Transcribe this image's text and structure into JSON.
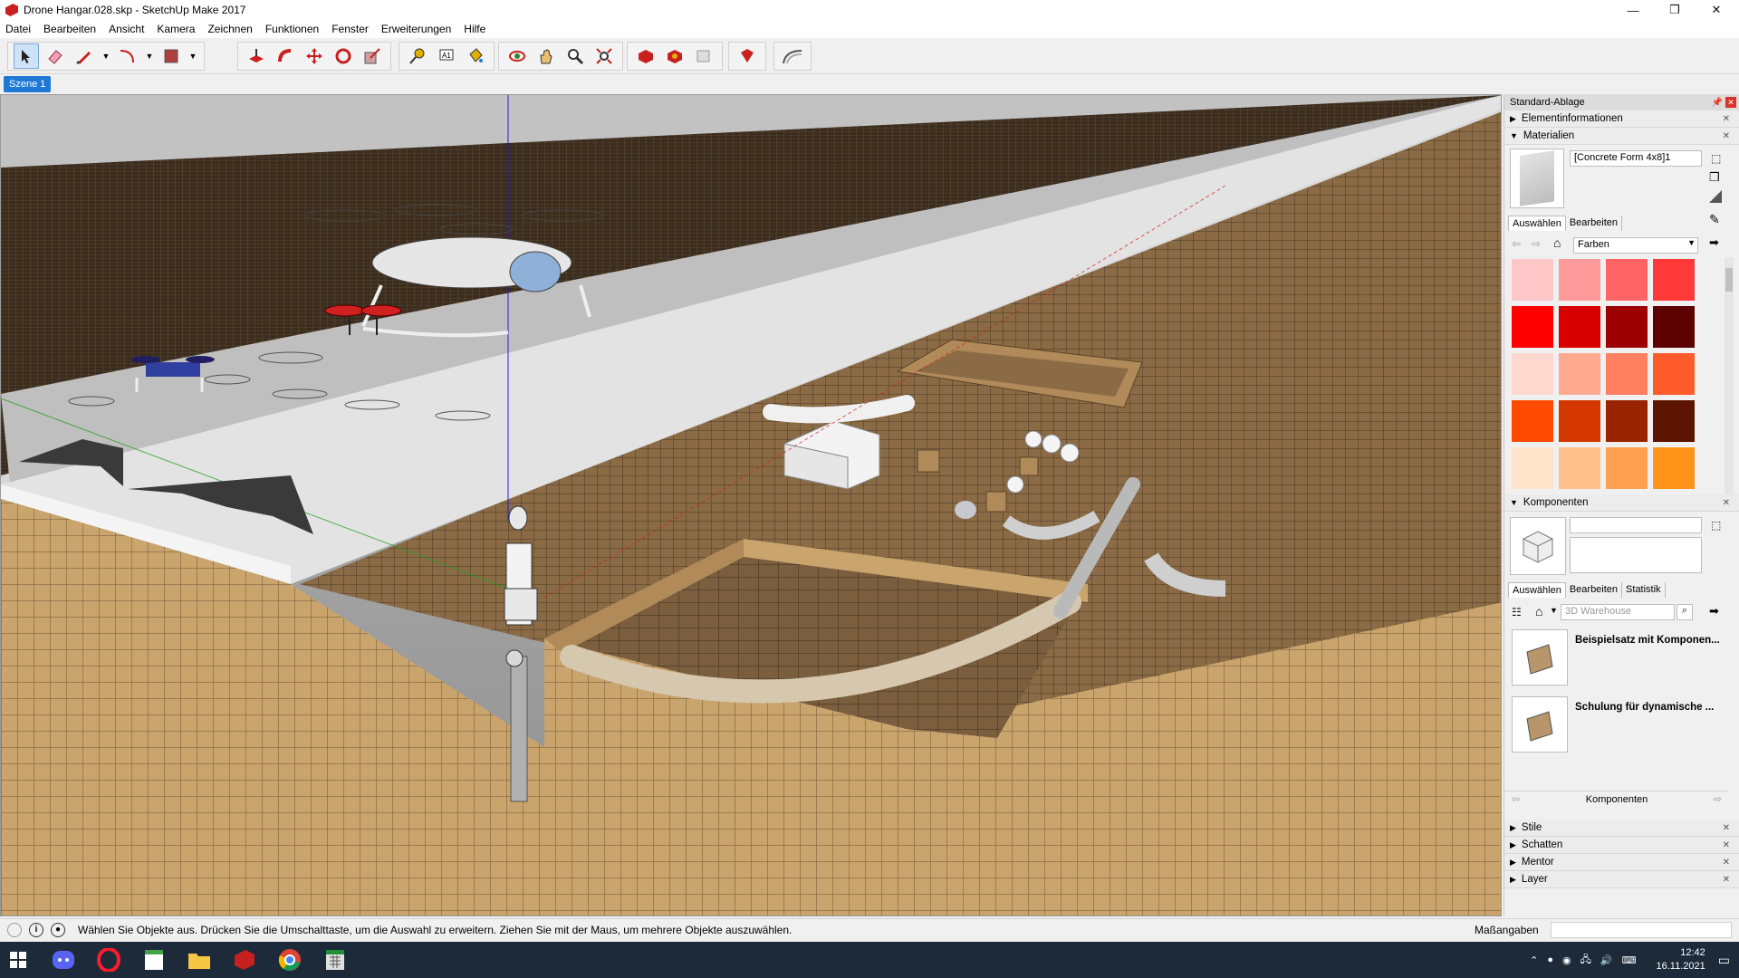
{
  "window": {
    "title": "Drone Hangar.028.skp - SketchUp Make 2017",
    "minimize": "—",
    "restore": "❐",
    "close": "✕"
  },
  "menu": [
    "Datei",
    "Bearbeiten",
    "Ansicht",
    "Kamera",
    "Zeichnen",
    "Funktionen",
    "Fenster",
    "Erweiterungen",
    "Hilfe"
  ],
  "toolbar": {
    "groups": [
      [
        "select-icon",
        "eraser-icon",
        "pencil-line-icon",
        "dropdown-icon",
        "arc-icon",
        "dropdown-icon",
        "rectangle-icon",
        "dropdown-icon"
      ],
      [
        "push-pull-icon",
        "follow-me-icon",
        "move-icon",
        "rotate-icon",
        "scale-icon"
      ],
      [
        "tape-measure-icon",
        "text-icon",
        "paint-bucket-icon"
      ],
      [
        "orbit-icon",
        "pan-icon",
        "zoom-icon",
        "zoom-extents-icon"
      ],
      [
        "3d-warehouse-icon",
        "extension-warehouse-icon",
        "send-to-layout-icon"
      ],
      [
        "extension-manager-icon"
      ],
      [
        "sandbox-icon"
      ]
    ]
  },
  "scenes": [
    "Szene 1"
  ],
  "tray": {
    "title": "Standard-Ablage",
    "entity_info": "Elementinformationen",
    "materials": {
      "title": "Materialien",
      "current_name": "[Concrete Form 4x8]1",
      "tabs": [
        "Auswählen",
        "Bearbeiten"
      ],
      "collection": "Farben",
      "swatches": [
        "#ffc8c8",
        "#ff9a9a",
        "#ff6464",
        "#ff3838",
        "#ff0000",
        "#d90000",
        "#9c0000",
        "#5c0000",
        "#ffd9d0",
        "#ffaa90",
        "#ff8060",
        "#ff5a2a",
        "#ff4a00",
        "#d43800",
        "#9a2400",
        "#5c1400",
        "#ffe4cc",
        "#ffc08a",
        "#ffa050",
        "#ff9418",
        "#f07800",
        "#d06000",
        "#a04800",
        "#6a3000"
      ]
    },
    "components": {
      "title": "Komponenten",
      "tabs": [
        "Auswählen",
        "Bearbeiten",
        "Statistik"
      ],
      "search_placeholder": "3D Warehouse",
      "items": [
        {
          "title": "Beispielsatz mit Komponen..."
        },
        {
          "title": "Schulung für dynamische ..."
        }
      ],
      "footer": "Komponenten"
    },
    "collapsed": [
      "Stile",
      "Schatten",
      "Mentor",
      "Layer"
    ]
  },
  "status": {
    "message": "Wählen Sie Objekte aus. Drücken Sie die Umschalttaste, um die Auswahl zu erweitern. Ziehen Sie mit der Maus, um mehrere Objekte auszuwählen.",
    "measure_label": "Maßangaben",
    "measure_value": ""
  },
  "taskbar": {
    "apps": [
      "windows-start-icon",
      "discord-icon",
      "opera-icon",
      "notepad-icon",
      "file-explorer-icon",
      "sketchup-icon",
      "chrome-icon",
      "spreadsheet-icon"
    ],
    "time": "12:42",
    "date": "16.11.2021"
  }
}
